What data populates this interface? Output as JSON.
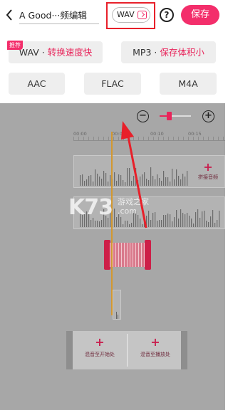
{
  "header": {
    "back_icon": "chevron-left-icon",
    "title": "A Good···频编辑",
    "format_button_label": "WAV",
    "format_icon": "switch-icon",
    "help_label": "?",
    "save_label": "保存",
    "colors": {
      "accent": "#f32e6b",
      "highlight_box": "#e8202a"
    }
  },
  "formats": {
    "recommend_badge": "推荐",
    "wav": {
      "name": "WAV",
      "sep": " · ",
      "desc": "转换速度快"
    },
    "mp3": {
      "name": "MP3",
      "sep": " · ",
      "desc": "保存体积小"
    },
    "aac": "AAC",
    "flac": "FLAC",
    "m4a": "M4A"
  },
  "editor": {
    "zoom_out_icon": "zoom-out-icon",
    "zoom_in_icon": "zoom-in-icon",
    "zoom_level": 0.3,
    "times": [
      "00:00",
      "00:05",
      "00:10",
      "00:15"
    ],
    "splice_plus": "+",
    "splice_label": "拼接音频",
    "mix_start_plus": "+",
    "mix_start_label": "混音至开始处",
    "mix_play_plus": "+",
    "mix_play_label": "混音至播放处"
  },
  "watermark": {
    "logo_text": "K73",
    "cn_text": "游戏之家",
    "url_text": ".com"
  }
}
